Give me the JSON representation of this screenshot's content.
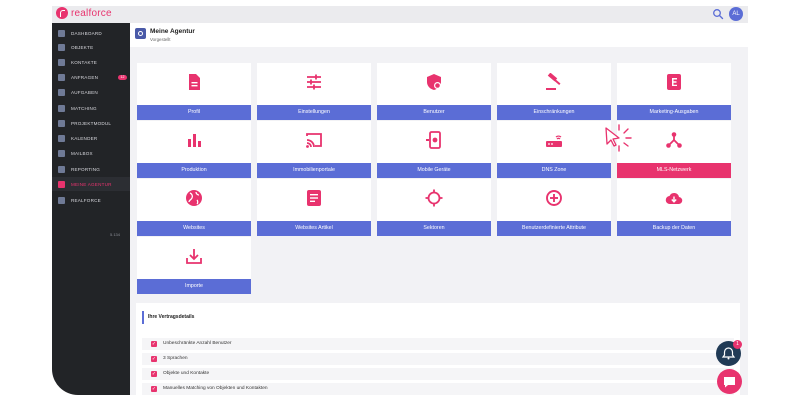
{
  "brand": {
    "name": "realforce",
    "color": "#e8336e"
  },
  "topbar": {
    "search_icon": "search-icon",
    "avatar_initials": "AL"
  },
  "sidebar": {
    "items": [
      {
        "label": "DASHBOARD",
        "icon": "dashboard-icon"
      },
      {
        "label": "OBJEKTE",
        "icon": "building-icon"
      },
      {
        "label": "KONTAKTE",
        "icon": "contacts-icon"
      },
      {
        "label": "ANFRAGEN",
        "icon": "inquiries-icon",
        "badge": "12"
      },
      {
        "label": "AUFGABEN",
        "icon": "tasks-icon"
      },
      {
        "label": "MATCHING",
        "icon": "matching-icon"
      },
      {
        "label": "PROJEKTMODUL",
        "icon": "project-icon"
      },
      {
        "label": "KALENDER",
        "icon": "calendar-icon"
      },
      {
        "label": "MAILBOX",
        "icon": "mail-icon"
      },
      {
        "label": "REPORTING",
        "icon": "reporting-icon"
      },
      {
        "label": "MEINE AGENTUR",
        "icon": "agency-icon",
        "active": true
      },
      {
        "label": "REALFORCE",
        "icon": "realforce-icon"
      }
    ],
    "version": "5.134"
  },
  "header": {
    "title": "Meine Agentur",
    "subtitle": "Vorgestellt"
  },
  "tiles": [
    {
      "label": "Profil",
      "icon": "document-icon"
    },
    {
      "label": "Einstellungen",
      "icon": "sliders-icon"
    },
    {
      "label": "Benutzer",
      "icon": "shield-user-icon"
    },
    {
      "label": "Einschränkungen",
      "icon": "gavel-icon"
    },
    {
      "label": "Marketing-Ausgaben",
      "icon": "letter-e-icon"
    },
    {
      "label": "Produktion",
      "icon": "bar-chart-icon"
    },
    {
      "label": "Immobilienportale",
      "icon": "cast-icon"
    },
    {
      "label": "Mobile Geräte",
      "icon": "mobile-settings-icon"
    },
    {
      "label": "DNS Zone",
      "icon": "router-icon"
    },
    {
      "label": "MLS-Netzwerk",
      "icon": "network-icon",
      "highlight": true
    },
    {
      "label": "Websites",
      "icon": "globe-icon"
    },
    {
      "label": "Websites Artikel",
      "icon": "article-icon"
    },
    {
      "label": "Sektoren",
      "icon": "crosshair-icon"
    },
    {
      "label": "Benutzerdefinierte Attribute",
      "icon": "add-circle-icon"
    },
    {
      "label": "Backup der Daten",
      "icon": "cloud-download-icon"
    },
    {
      "label": "Importe",
      "icon": "download-icon"
    }
  ],
  "contract": {
    "title": "Ihre Vertragsdetails",
    "features": [
      "Unbeschränkte Anzahl Benutzer",
      "3 Sprachen",
      "Objekte und Kontakte",
      "Manuelles Matching von Objekten und Kontakten"
    ]
  },
  "notifications": {
    "badge": "1"
  },
  "colors": {
    "accent": "#e8336e",
    "primary": "#5b6dd6",
    "sidebar": "#222427",
    "header_icon": "#4a5aa8"
  }
}
